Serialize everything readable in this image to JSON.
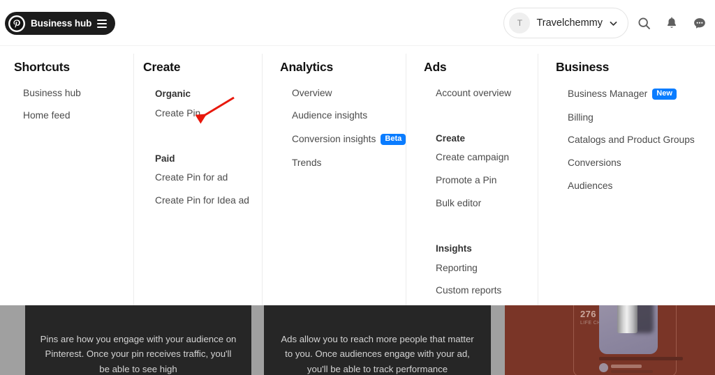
{
  "topbar": {
    "hub_button_label": "Business hub",
    "logo_icon": "pinterest-logo-icon",
    "menu_icon": "hamburger-menu-icon",
    "account": {
      "avatar_initial": "T",
      "name": "Travelchemmy",
      "chevron_icon": "chevron-down-icon"
    },
    "icons": [
      {
        "name": "search-icon",
        "label": "Search"
      },
      {
        "name": "bell-icon",
        "label": "Notifications"
      },
      {
        "name": "chat-icon",
        "label": "Messages"
      }
    ]
  },
  "megamenu": {
    "columns": [
      {
        "title": "Shortcuts",
        "groups": [
          {
            "subtitle": "",
            "items": [
              {
                "label": "Business hub",
                "badge": ""
              },
              {
                "label": "Home feed",
                "badge": ""
              }
            ]
          }
        ]
      },
      {
        "title": "Create",
        "groups": [
          {
            "subtitle": "Organic",
            "items": [
              {
                "label": "Create Pin",
                "badge": ""
              }
            ]
          },
          {
            "subtitle": "Paid",
            "items": [
              {
                "label": "Create Pin for ad",
                "badge": ""
              },
              {
                "label": "Create Pin for Idea ad",
                "badge": ""
              }
            ]
          }
        ]
      },
      {
        "title": "Analytics",
        "groups": [
          {
            "subtitle": "",
            "items": [
              {
                "label": "Overview",
                "badge": ""
              },
              {
                "label": "Audience insights",
                "badge": ""
              },
              {
                "label": "Conversion insights",
                "badge": "Beta"
              },
              {
                "label": "Trends",
                "badge": ""
              }
            ]
          }
        ]
      },
      {
        "title": "Ads",
        "groups": [
          {
            "subtitle": "",
            "items": [
              {
                "label": "Account overview",
                "badge": ""
              }
            ]
          },
          {
            "subtitle": "Create",
            "items": [
              {
                "label": "Create campaign",
                "badge": ""
              },
              {
                "label": "Promote a Pin",
                "badge": ""
              },
              {
                "label": "Bulk editor",
                "badge": ""
              }
            ]
          },
          {
            "subtitle": "Insights",
            "items": [
              {
                "label": "Reporting",
                "badge": ""
              },
              {
                "label": "Custom reports",
                "badge": ""
              }
            ]
          }
        ]
      },
      {
        "title": "Business",
        "groups": [
          {
            "subtitle": "",
            "items": [
              {
                "label": "Business Manager",
                "badge": "New"
              },
              {
                "label": "Billing",
                "badge": ""
              },
              {
                "label": "Catalogs and Product Groups",
                "badge": ""
              },
              {
                "label": "Conversions",
                "badge": ""
              },
              {
                "label": "Audiences",
                "badge": ""
              }
            ]
          }
        ]
      }
    ]
  },
  "annotation": {
    "type": "red-arrow",
    "points_to": "Create Pin",
    "color": "#e8180c"
  },
  "background_cards": [
    {
      "name": "pins-card",
      "text": "Pins are how you engage with your audience on Pinterest. Once your pin receives traffic, you'll be able to see high"
    },
    {
      "name": "ads-card",
      "text": "Ads allow you to reach more people that matter to you. Once audiences engage with your ad, you'll be able to track performance"
    },
    {
      "name": "preview-card",
      "stat_value": "276",
      "stat_label": "LIFE CHA"
    }
  ],
  "colors": {
    "accent_badge": "#0a7cff",
    "pill_dark": "#1c1c1c",
    "card_dark": "#262626",
    "card_image": "#7a3527",
    "annotation_red": "#e8180c"
  }
}
